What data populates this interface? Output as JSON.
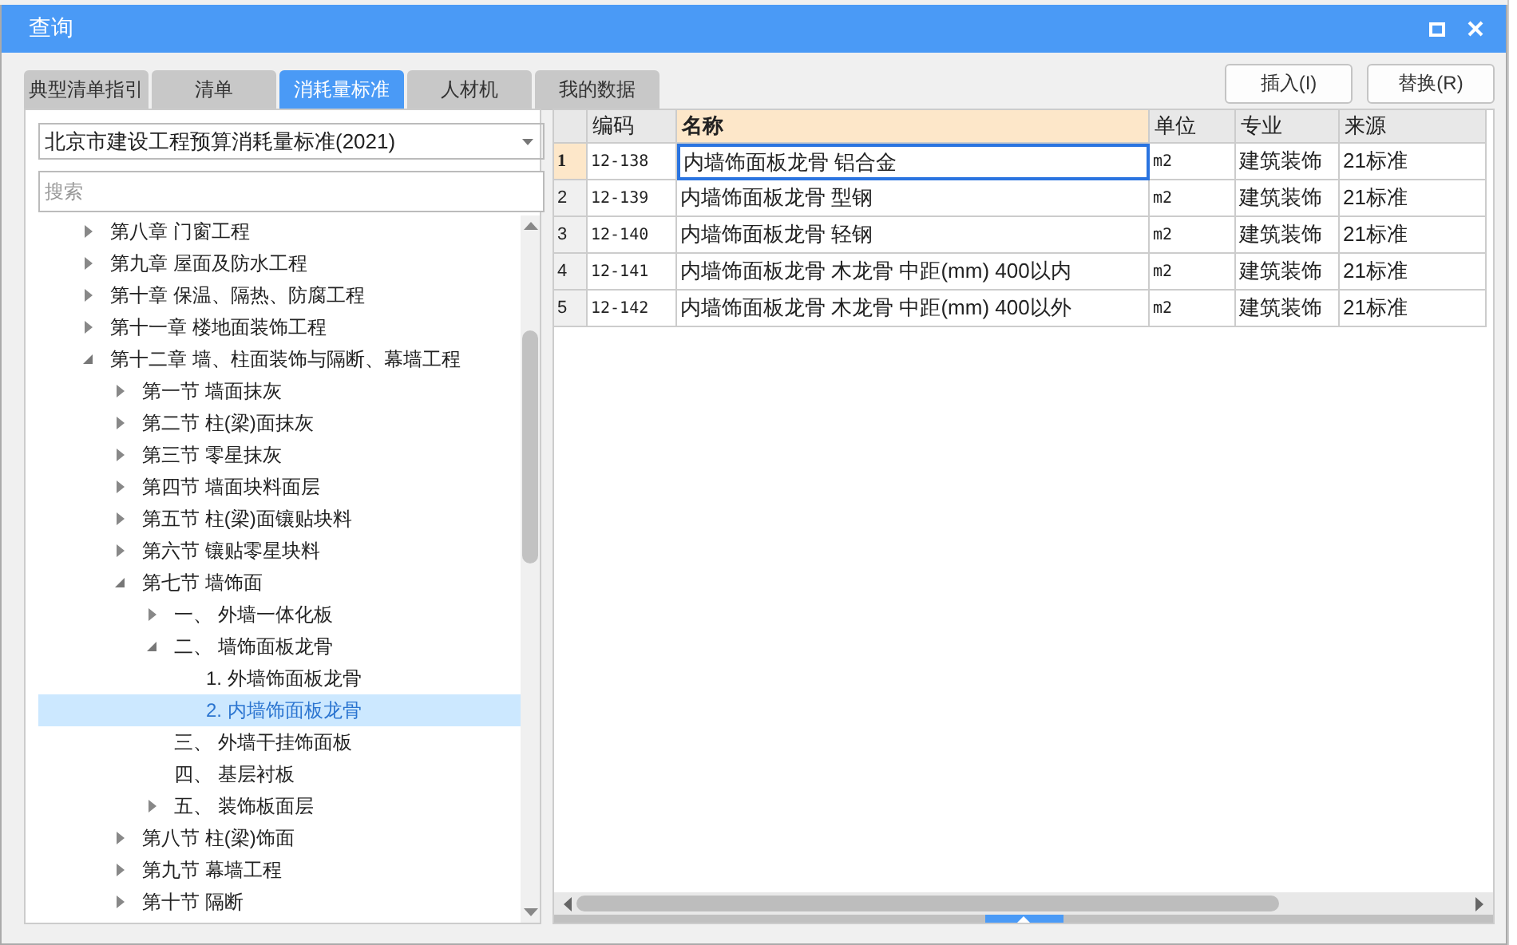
{
  "window": {
    "title": "查询"
  },
  "tabs": [
    {
      "label": "典型清单指引",
      "selected": false
    },
    {
      "label": "清单",
      "selected": false
    },
    {
      "label": "消耗量标准",
      "selected": true
    },
    {
      "label": "人材机",
      "selected": false
    },
    {
      "label": "我的数据",
      "selected": false
    }
  ],
  "buttons": [
    "插入(I)",
    "替换(R)"
  ],
  "standard_select": {
    "value": "北京市建设工程预算消耗量标准(2021)"
  },
  "search": {
    "placeholder": "搜索"
  },
  "tree": {
    "items": [
      {
        "label": "第八章 门窗工程",
        "expanded": false,
        "selected": false
      },
      {
        "label": "第九章 屋面及防水工程",
        "expanded": false,
        "selected": false
      },
      {
        "label": "第十章 保温、隔热、防腐工程",
        "expanded": false,
        "selected": false
      },
      {
        "label": "第十一章 楼地面装饰工程",
        "expanded": false,
        "selected": false
      },
      {
        "label": "第十二章 墙、柱面装饰与隔断、幕墙工程",
        "expanded": true,
        "selected": false,
        "children": [
          {
            "label": "第一节 墙面抹灰",
            "expanded": false,
            "selected": false
          },
          {
            "label": "第二节 柱(梁)面抹灰",
            "expanded": false,
            "selected": false
          },
          {
            "label": "第三节 零星抹灰",
            "expanded": false,
            "selected": false
          },
          {
            "label": "第四节 墙面块料面层",
            "expanded": false,
            "selected": false
          },
          {
            "label": "第五节 柱(梁)面镶贴块料",
            "expanded": false,
            "selected": false
          },
          {
            "label": "第六节 镶贴零星块料",
            "expanded": false,
            "selected": false
          },
          {
            "label": "第七节 墙饰面",
            "expanded": true,
            "selected": false,
            "children": [
              {
                "label": "一、 外墙一体化板",
                "expanded": false,
                "selected": false
              },
              {
                "label": "二、 墙饰面板龙骨",
                "expanded": true,
                "selected": false,
                "children": [
                  {
                    "label": "1. 外墙饰面板龙骨",
                    "selected": false
                  },
                  {
                    "label": "2. 内墙饰面板龙骨",
                    "selected": true
                  }
                ]
              },
              {
                "label": "三、 外墙干挂饰面板",
                "selected": false
              },
              {
                "label": "四、 基层衬板",
                "selected": false
              },
              {
                "label": "五、 装饰板面层",
                "expanded": false,
                "selected": false
              }
            ]
          },
          {
            "label": "第八节 柱(梁)饰面",
            "expanded": false,
            "selected": false
          },
          {
            "label": "第九节 幕墙工程",
            "expanded": false,
            "selected": false
          },
          {
            "label": "第十节 隔断",
            "expanded": false,
            "selected": false
          }
        ]
      }
    ]
  },
  "table": {
    "columns": [
      {
        "label": "编码",
        "selected": false
      },
      {
        "label": "名称",
        "selected": true
      },
      {
        "label": "单位",
        "selected": false
      },
      {
        "label": "专业",
        "selected": false
      },
      {
        "label": "来源",
        "selected": false
      }
    ],
    "rows": [
      {
        "number": "1",
        "selected": true,
        "cells": [
          "12-138",
          "内墙饰面板龙骨 铝合金",
          "m2",
          "建筑装饰",
          "21标准"
        ]
      },
      {
        "number": "2",
        "selected": false,
        "cells": [
          "12-139",
          "内墙饰面板龙骨 型钢",
          "m2",
          "建筑装饰",
          "21标准"
        ]
      },
      {
        "number": "3",
        "selected": false,
        "cells": [
          "12-140",
          "内墙饰面板龙骨 轻钢",
          "m2",
          "建筑装饰",
          "21标准"
        ]
      },
      {
        "number": "4",
        "selected": false,
        "cells": [
          "12-141",
          "内墙饰面板龙骨 木龙骨 中距(mm) 400以内",
          "m2",
          "建筑装饰",
          "21标准"
        ]
      },
      {
        "number": "5",
        "selected": false,
        "cells": [
          "12-142",
          "内墙饰面板龙骨 木龙骨 中距(mm) 400以外",
          "m2",
          "建筑装饰",
          "21标准"
        ]
      }
    ]
  }
}
